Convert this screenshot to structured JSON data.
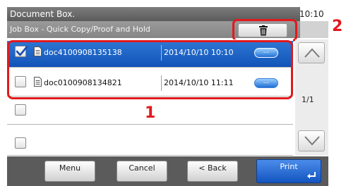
{
  "header": {
    "title": "Document Box.",
    "clock": "10:10",
    "subtitle": "Job Box - Quick Copy/Proof and Hold"
  },
  "files": [
    {
      "name": "doc4100908135138",
      "date": "2014/10/10 10:10",
      "selected": true,
      "more_label": "..."
    },
    {
      "name": "doc0100908134821",
      "date": "2014/10/10 11:11",
      "selected": false,
      "more_label": "..."
    }
  ],
  "pagination": {
    "label": "1/1"
  },
  "buttons": {
    "menu": "Menu",
    "cancel": "Cancel",
    "back": "< Back",
    "print": "Print"
  },
  "callouts": {
    "one": "1",
    "two": "2"
  },
  "colors": {
    "selection": "#1a5fc4",
    "callout": "#e1191d",
    "print_button": "#2a6fd8"
  },
  "icons": [
    "trash-icon",
    "checkbox-checked-icon",
    "document-icon",
    "chevron-up-icon",
    "chevron-down-icon",
    "enter-icon"
  ]
}
